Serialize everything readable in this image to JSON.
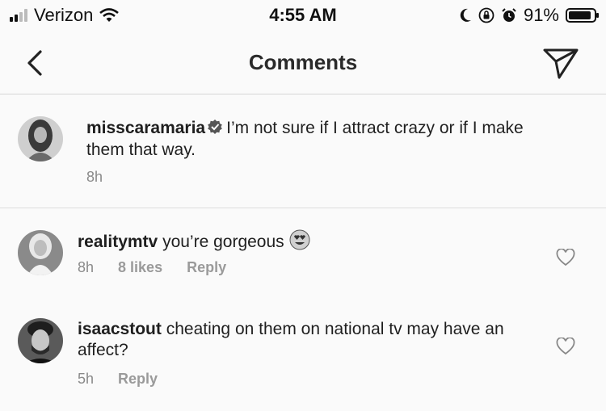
{
  "status": {
    "carrier": "Verizon",
    "time": "4:55 AM",
    "battery": "91%",
    "battery_level": 0.91
  },
  "nav": {
    "title": "Comments"
  },
  "caption": {
    "username": "misscaramaria",
    "text": "I’m not sure if I attract crazy or if I make them that way.",
    "time": "8h"
  },
  "comments": [
    {
      "username": "realitymtv",
      "text": "you’re gorgeous",
      "emoji": "heart-eyes-emoji",
      "time": "8h",
      "likes": "8 likes",
      "reply": "Reply"
    },
    {
      "username": "isaacstout",
      "text": "cheating on them on national tv may have an affect?",
      "time": "5h",
      "reply": "Reply"
    }
  ]
}
